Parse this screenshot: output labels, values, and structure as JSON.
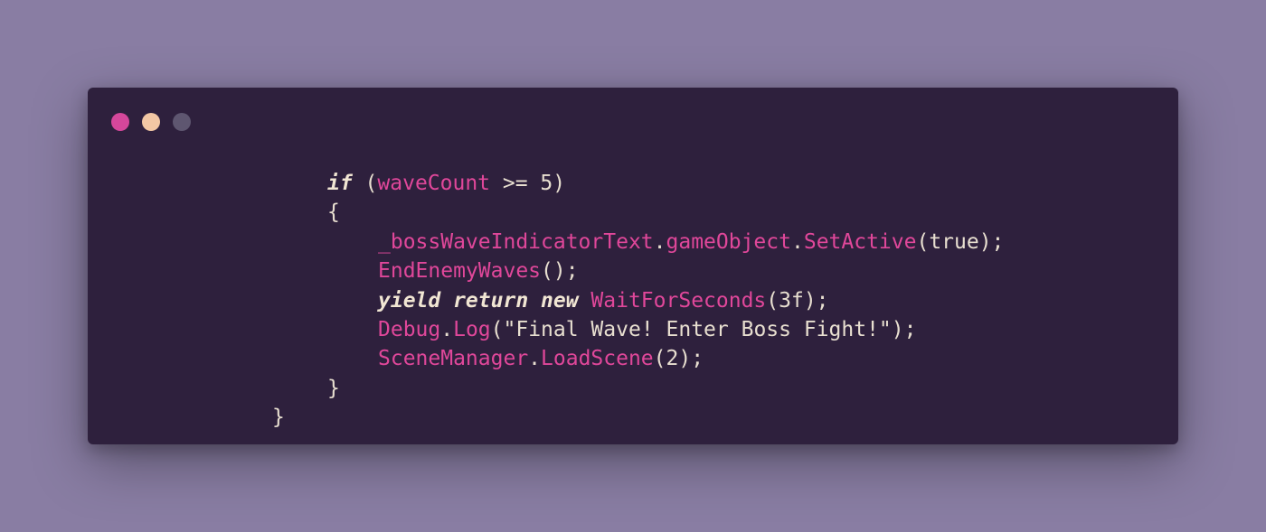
{
  "window": {
    "dots": [
      {
        "name": "close-dot",
        "color": "#d5479b"
      },
      {
        "name": "minimize-dot",
        "color": "#f2c7a4"
      },
      {
        "name": "maximize-dot",
        "color": "#5e5670"
      }
    ]
  },
  "colors": {
    "keyword": "#f1e6d3",
    "identifier": "#e0479a",
    "plain": "#e8dfd0",
    "string": "#e8dfd0",
    "number": "#e8dfd0"
  },
  "code": {
    "line1": {
      "kw": "if",
      "open": " (",
      "var": "waveCount",
      "op": " >= ",
      "num": "5",
      "close": ")"
    },
    "line2": {
      "text": "{"
    },
    "line3": {
      "obj": "_bossWaveIndicatorText",
      "dot1": ".",
      "prop": "gameObject",
      "dot2": ".",
      "method": "SetActive",
      "args": "(true);"
    },
    "line4": {
      "method": "EndEnemyWaves",
      "args": "();"
    },
    "line5": {
      "kw": "yield return new",
      "space": " ",
      "method": "WaitForSeconds",
      "args": "(3f);"
    },
    "line6": {
      "obj": "Debug",
      "dot": ".",
      "method": "Log",
      "args": "(\"Final Wave! Enter Boss Fight!\");"
    },
    "line7": {
      "obj": "SceneManager",
      "dot": ".",
      "method": "LoadScene",
      "args": "(2);"
    },
    "line8": {
      "text": "}"
    },
    "line9": {
      "text": "}"
    }
  }
}
